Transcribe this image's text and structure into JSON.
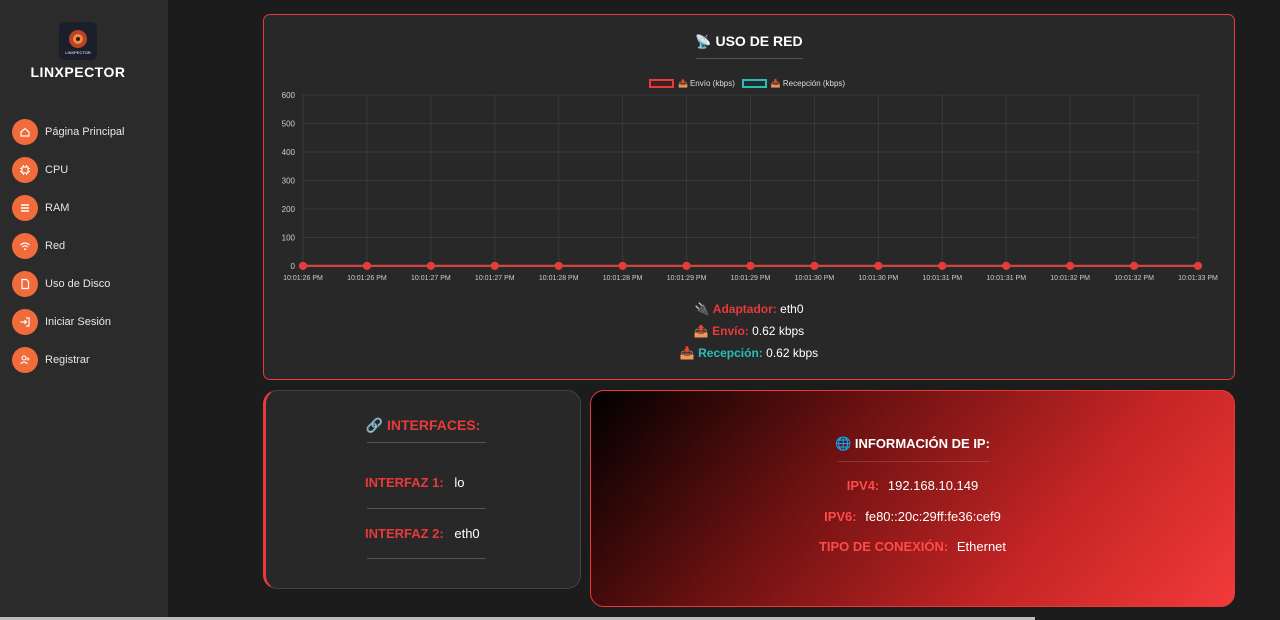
{
  "app": {
    "brand": "LINXPECTOR",
    "logo_text": "LINXPECTOR"
  },
  "sidebar": {
    "items": [
      {
        "label": "Página Principal",
        "icon": "home-icon"
      },
      {
        "label": "CPU",
        "icon": "cpu-icon"
      },
      {
        "label": "RAM",
        "icon": "ram-icon"
      },
      {
        "label": "Red",
        "icon": "wifi-icon"
      },
      {
        "label": "Uso de Disco",
        "icon": "disk-icon"
      },
      {
        "label": "Iniciar Sesión",
        "icon": "login-icon"
      },
      {
        "label": "Registrar",
        "icon": "user-add-icon"
      }
    ]
  },
  "network": {
    "title": "USO DE RED",
    "adapter_label": "Adaptador:",
    "adapter_value": "eth0",
    "send_label": "Envío:",
    "send_value": "0.62 kbps",
    "recv_label": "Recepción:",
    "recv_value": "0.62 kbps"
  },
  "chart_data": {
    "type": "line",
    "categories": [
      "10:01:26 PM",
      "10:01:26 PM",
      "10:01:27 PM",
      "10:01:27 PM",
      "10:01:28 PM",
      "10:01:28 PM",
      "10:01:29 PM",
      "10:01:29 PM",
      "10:01:30 PM",
      "10:01:30 PM",
      "10:01:31 PM",
      "10:01:31 PM",
      "10:01:32 PM",
      "10:01:32 PM",
      "10:01:33 PM"
    ],
    "series": [
      {
        "name": "Envío (kbps)",
        "color": "#e83a3a",
        "values": [
          0.62,
          0.62,
          0.62,
          0.62,
          0.62,
          0.62,
          0.62,
          0.62,
          0.62,
          0.62,
          0.62,
          0.62,
          0.62,
          0.62,
          0.62
        ]
      },
      {
        "name": "Recepción (kbps)",
        "color": "#2bbdb5",
        "values": [
          0.62,
          0.62,
          0.62,
          0.62,
          0.62,
          0.62,
          0.62,
          0.62,
          0.62,
          0.62,
          0.62,
          0.62,
          0.62,
          0.62,
          0.62
        ]
      }
    ],
    "yticks": [
      0,
      100,
      200,
      300,
      400,
      500,
      600
    ],
    "ylim": [
      0,
      600
    ],
    "grid": true,
    "legend": "top"
  },
  "interfaces": {
    "title": "INTERFACES:",
    "items": [
      {
        "label": "INTERFAZ 1:",
        "value": "lo"
      },
      {
        "label": "INTERFAZ 2:",
        "value": "eth0"
      }
    ]
  },
  "ip_info": {
    "title": "INFORMACIÓN DE IP:",
    "ipv4_label": "IPV4:",
    "ipv4_value": "192.168.10.149",
    "ipv6_label": "IPV6:",
    "ipv6_value": "fe80::20c:29ff:fe36:cef9",
    "conn_label": "TIPO DE CONEXIÓN:",
    "conn_value": "Ethernet"
  }
}
